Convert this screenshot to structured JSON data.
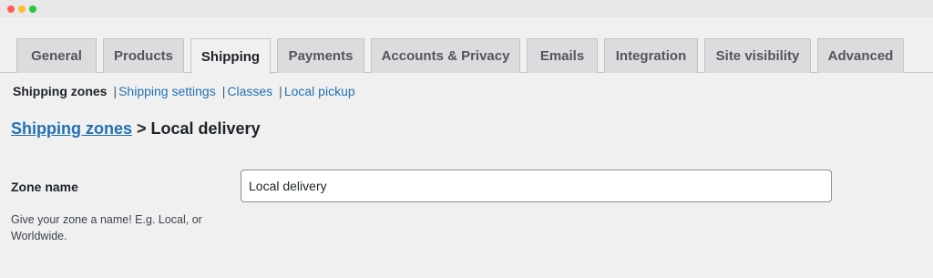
{
  "window": {
    "controls": [
      "close",
      "minimize",
      "maximize"
    ]
  },
  "tabs": [
    {
      "label": "General",
      "active": false
    },
    {
      "label": "Products",
      "active": false
    },
    {
      "label": "Shipping",
      "active": true
    },
    {
      "label": "Payments",
      "active": false
    },
    {
      "label": "Accounts & Privacy",
      "active": false
    },
    {
      "label": "Emails",
      "active": false
    },
    {
      "label": "Integration",
      "active": false
    },
    {
      "label": "Site visibility",
      "active": false
    },
    {
      "label": "Advanced",
      "active": false
    }
  ],
  "subnav": {
    "current": "Shipping zones",
    "separator": "|",
    "links": [
      "Shipping settings",
      "Classes",
      "Local pickup"
    ]
  },
  "heading": {
    "link": "Shipping zones",
    "arrow": ">",
    "title": "Local delivery"
  },
  "zone_name": {
    "label": "Zone name",
    "description": "Give your zone a name! E.g. Local, or Worldwide.",
    "value": "Local delivery"
  },
  "colors": {
    "link": "#2271b1",
    "background": "#f0f0f1",
    "tab_inactive": "#dcdcde"
  }
}
